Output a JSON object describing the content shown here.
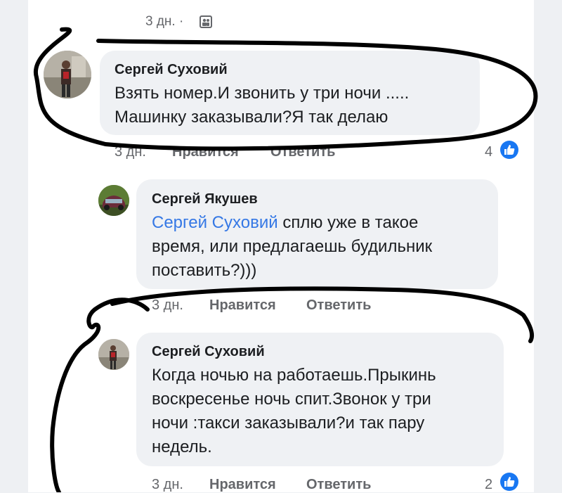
{
  "top_meta": {
    "time": "3 дн. ·",
    "audience_icon": "friends-icon"
  },
  "comments": [
    {
      "author": "Сергей Суховий",
      "lines": [
        "Взять номер.И звонить у три ночи .....",
        "Машинку заказывали?Я так делаю"
      ],
      "time": "3 дн.",
      "like": "Нравится",
      "reply": "Ответить",
      "reactions": "4",
      "reaction_icon": "like-icon"
    },
    {
      "author": "Сергей Якушев",
      "mention": "Сергей Суховий",
      "lines": [
        " сплю уже в такое",
        "время, или предлагаешь будильник",
        "поставить?)))"
      ],
      "time": "3 дн.",
      "like": "Нравится",
      "reply": "Ответить"
    },
    {
      "author": "Сергей Суховий",
      "lines": [
        "Когда ночью на работаешь.Прыкинь",
        "воскресенье ночь спит.Звонок у три",
        "ночи :такси заказывали?и так пару",
        "недель."
      ],
      "time": "3 дн.",
      "like": "Нравится",
      "reply": "Ответить",
      "reactions": "2",
      "reaction_icon": "like-icon"
    }
  ],
  "colors": {
    "accent": "#1877f2",
    "bubble": "#eff1f4",
    "mention": "#3578e5",
    "ink": "#000000"
  }
}
